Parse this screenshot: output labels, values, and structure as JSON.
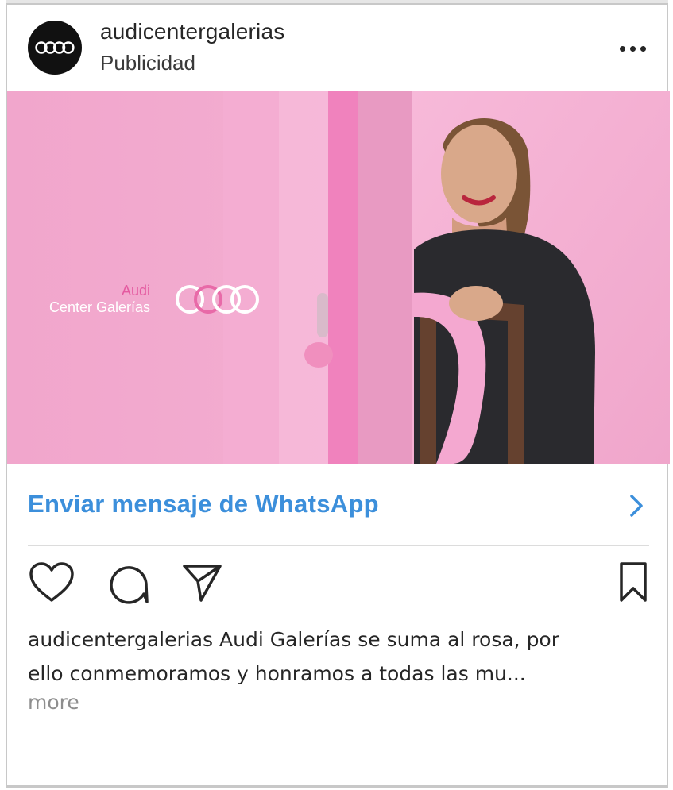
{
  "post": {
    "username": "audicentergalerias",
    "sponsored_label": "Publicidad",
    "avatar_icon": "audi-rings-logo",
    "menu_icon": "more-options-icon"
  },
  "media": {
    "brand_line1": "Audi",
    "brand_line2": "Center Galerías",
    "logo_icon": "audi-rings-pink-ribbon-logo",
    "background_color": "#f3afd3"
  },
  "cta": {
    "label": "Enviar mensaje de WhatsApp",
    "color": "#3c8fdb",
    "icon": "chevron-right-icon"
  },
  "actions": {
    "like_icon": "heart-icon",
    "comment_icon": "comment-icon",
    "share_icon": "send-icon",
    "save_icon": "bookmark-icon"
  },
  "caption": {
    "line1": "audicentergalerias Audi Galerías se suma al rosa, por",
    "line2": "ello conmemoramos y honramos a todas las mu...",
    "more_label": "more"
  }
}
